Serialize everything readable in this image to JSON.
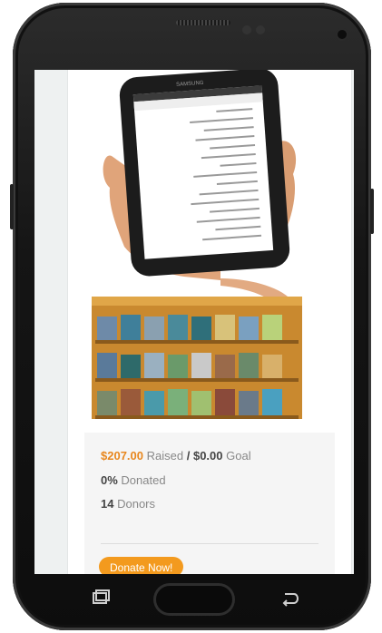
{
  "device": {
    "brand": "SAMSUNG"
  },
  "campaign": {
    "raised_amount": "$207.00",
    "raised_label": "Raised",
    "separator": "/",
    "goal_amount": "$0.00",
    "goal_label": "Goal",
    "percent": "0%",
    "percent_label": "Donated",
    "donors_count": "14",
    "donors_label": "Donors",
    "donate_button": "Donate Now!"
  },
  "colors": {
    "accent": "#f39a1e",
    "amount": "#e8871e"
  },
  "icons": [
    "recent-apps-icon",
    "back-icon"
  ]
}
